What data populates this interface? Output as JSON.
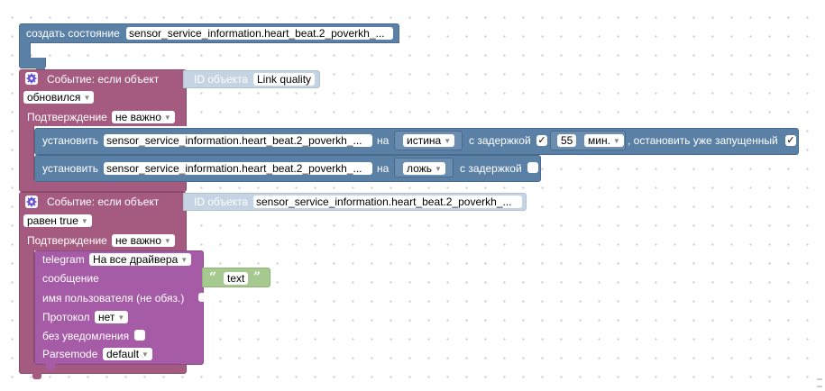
{
  "create_state": {
    "label": "создать состояние",
    "id_value": "sensor_service_information.heart_beat.2_poverkh_..."
  },
  "event1": {
    "title": "Событие: если объект",
    "id_label": "ID объекта",
    "id_value": "Link quality",
    "condition": "обновился",
    "ack_label": "Подтверждение",
    "ack_value": "не важно"
  },
  "set1": {
    "label": "установить",
    "id_value": "sensor_service_information.heart_beat.2_poverkh_...",
    "on_label": "на",
    "value": "истина",
    "delay_label": "с задержкой",
    "delay_checked": "✓",
    "delay_value": "55",
    "delay_unit": "мин.",
    "stop_label": ", остановить уже запущенный",
    "stop_checked": "✓"
  },
  "set2": {
    "label": "установить",
    "id_value": "sensor_service_information.heart_beat.2_poverkh_...",
    "on_label": "на",
    "value": "ложь",
    "delay_label": "с задержкой"
  },
  "event2": {
    "title": "Событие: если объект",
    "id_label": "ID объекта",
    "id_value": "sensor_service_information.heart_beat.2_poverkh_...",
    "condition": "равен true",
    "ack_label": "Подтверждение",
    "ack_value": "не важно"
  },
  "telegram": {
    "label": "telegram",
    "recipient": "На все драйвера",
    "message_label": "сообщение",
    "message_text": "text",
    "user_label": "имя пользователя (не обяз.)",
    "protocol_label": "Протокол",
    "protocol_value": "нет",
    "silent_label": "без уведомления",
    "parsemode_label": "Parsemode",
    "parsemode_value": "default"
  },
  "colors": {
    "blue": "#5b80a5",
    "pink": "#a55b80",
    "purple": "#a55ba5",
    "light": "#c5d4e2",
    "text_block": "#a5c98f"
  }
}
